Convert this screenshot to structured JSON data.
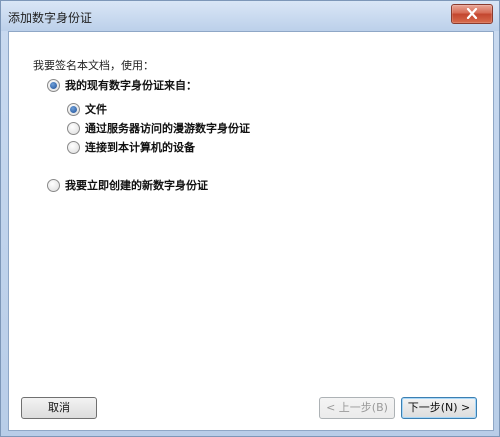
{
  "window": {
    "title": "添加数字身份证"
  },
  "form": {
    "prompt": "我要签名本文档，使用：",
    "option_existing": "我的现有数字身份证来自：",
    "sub_options": [
      {
        "label": "文件",
        "checked": true
      },
      {
        "label": "通过服务器访问的漫游数字身份证",
        "checked": false
      },
      {
        "label": "连接到本计算机的设备",
        "checked": false
      }
    ],
    "option_new": "我要立即创建的新数字身份证"
  },
  "buttons": {
    "cancel": "取消",
    "back": "< 上一步(B)",
    "next": "下一步(N) >"
  }
}
